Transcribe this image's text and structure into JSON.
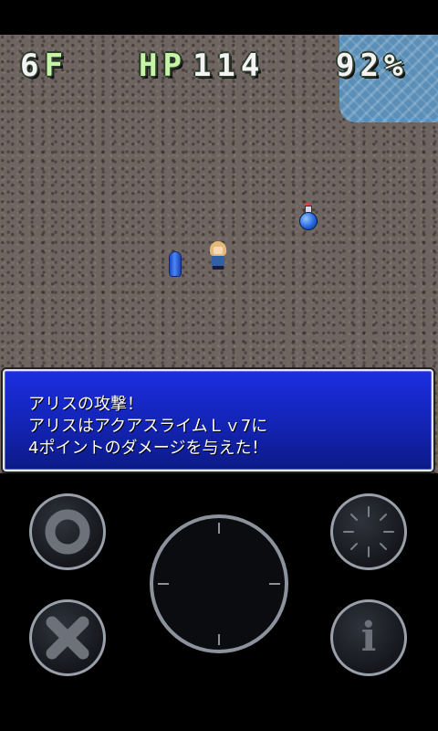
{
  "hud": {
    "floor_value": "6",
    "floor_label": "F",
    "hp_label": "HP",
    "hp_value": "114",
    "fullness": "92%"
  },
  "message": {
    "lines": [
      "アリスの攻撃！",
      "アリスはアクアスライムＬｖ7に",
      "4ポイントのダメージを与えた！"
    ]
  },
  "controls": {
    "confirm_icon": "circle-icon",
    "cancel_icon": "x-icon",
    "dpad_icon": "dpad-dial",
    "wait_icon": "clock-dial-icon",
    "info_icon": "info-icon",
    "info_glyph": "i"
  },
  "colors": {
    "message_bg": "#1324b4",
    "hud_label": "#c6f5a6",
    "water": "#5b8fb8",
    "floor": "#6f6560"
  }
}
